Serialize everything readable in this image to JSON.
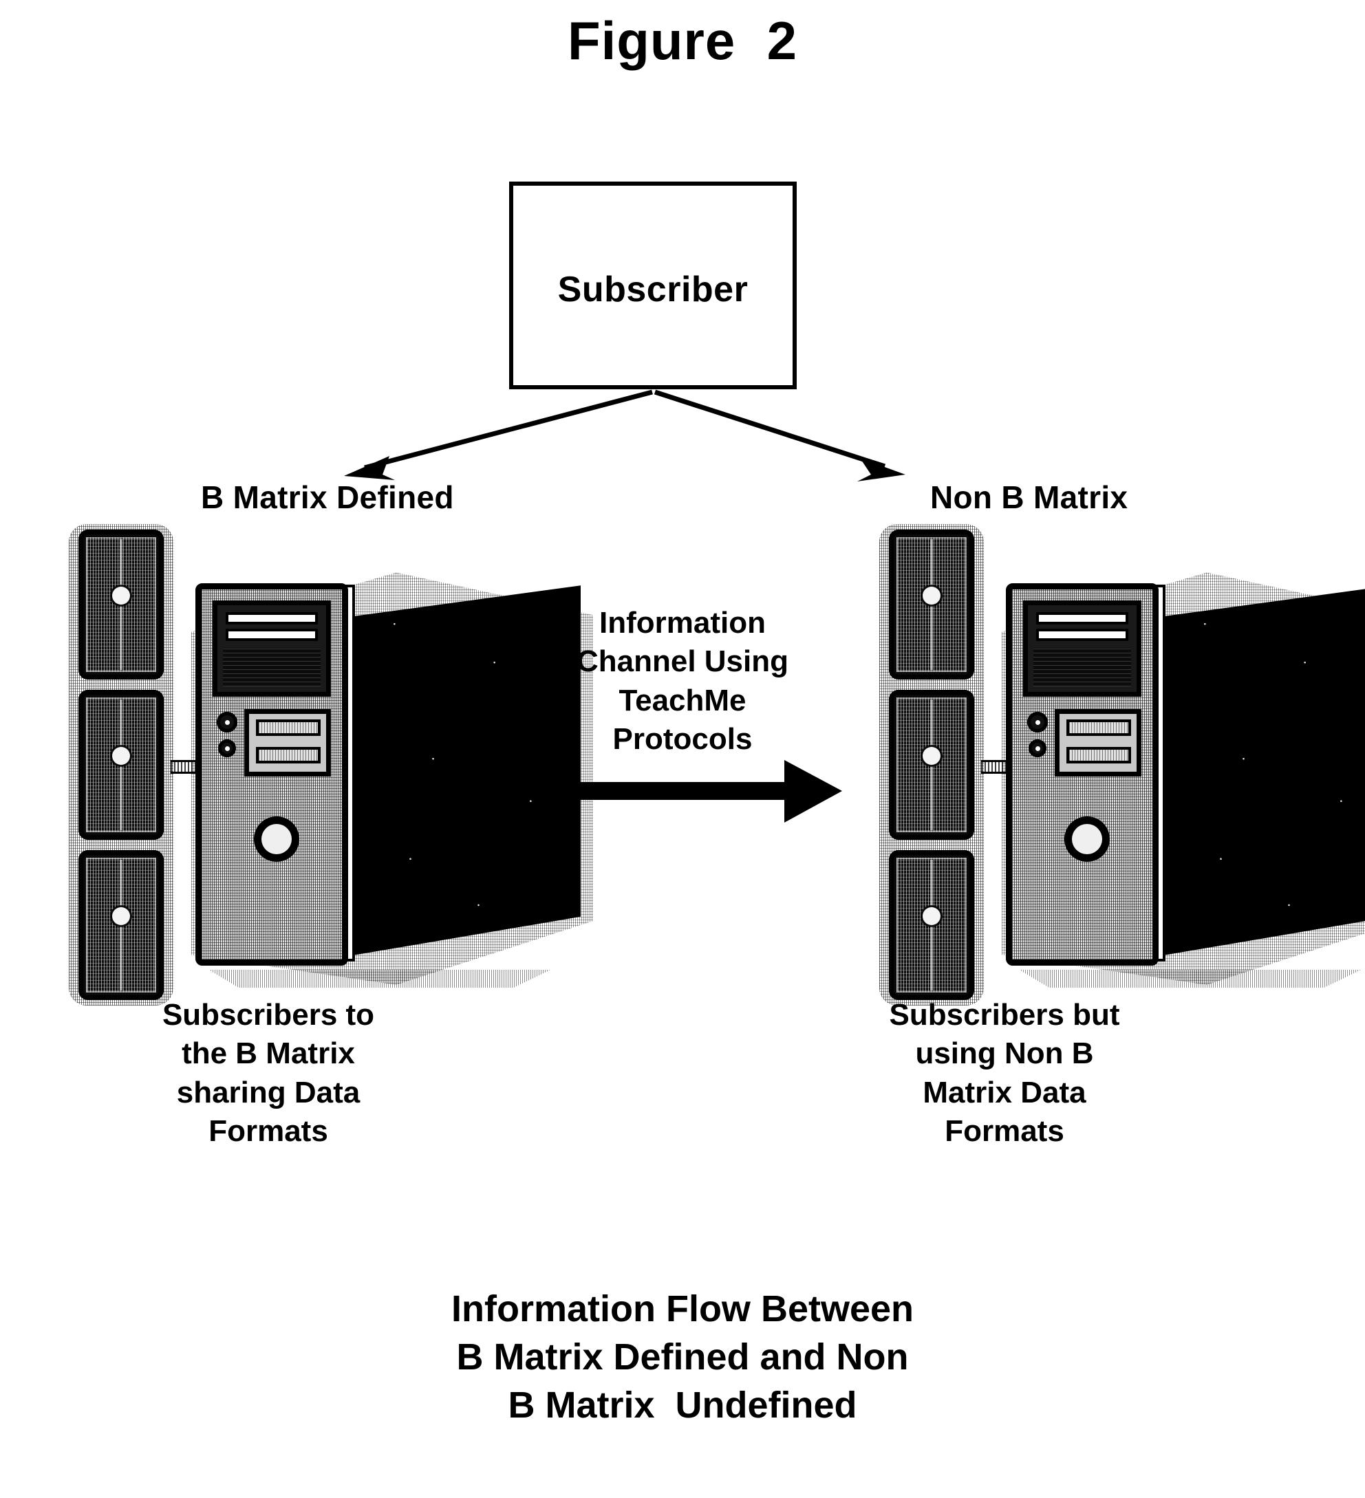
{
  "figure": {
    "title": "Figure  2",
    "caption_lines": [
      "Information Flow Between",
      "B Matrix Defined and Non",
      "B Matrix  Undefined"
    ]
  },
  "top_node": {
    "label": "Subscriber"
  },
  "branches": {
    "left_label": "B Matrix Defined",
    "right_label": "Non B Matrix"
  },
  "channel": {
    "lines": [
      "Information",
      "Channel Using",
      "TeachMe",
      "Protocols"
    ]
  },
  "left_group": {
    "caption_lines": [
      "Subscribers to",
      "the B Matrix",
      "sharing Data",
      "Formats"
    ],
    "computer_icon": "computer-tower-icon",
    "module_stack_icon": "drive-module-stack-icon",
    "module_count": 3
  },
  "right_group": {
    "caption_lines": [
      "Subscribers but",
      "using Non B",
      "Matrix Data",
      "Formats"
    ],
    "computer_icon": "computer-tower-icon",
    "module_stack_icon": "drive-module-stack-icon",
    "module_count": 3
  },
  "colors": {
    "ink": "#000000",
    "paper": "#ffffff"
  }
}
